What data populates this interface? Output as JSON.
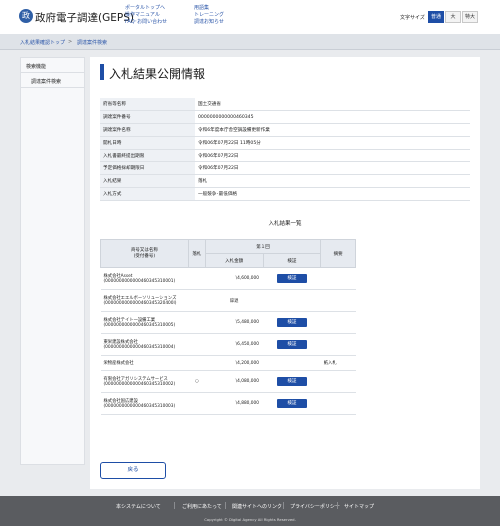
{
  "header": {
    "logo_glyph": "政",
    "title": "政府電子調達(GEPS)",
    "links_col1": [
      "ポータルトップへ",
      "操作マニュアル",
      "FAQ･お問い合わせ"
    ],
    "links_col2": [
      "用語集",
      "トレーニング",
      "調達お知らせ"
    ],
    "font_size_label": "文字サイズ",
    "font_sizes": [
      "普通",
      "大",
      "特大"
    ]
  },
  "breadcrumb": {
    "items": [
      "入札結果確認トップ",
      "調達案件検索"
    ],
    "separator": ">"
  },
  "sidebar": {
    "heading": "検索機能",
    "items": [
      "調達案件検索"
    ]
  },
  "page": {
    "title": "入札結果公開情報",
    "info": [
      {
        "label": "府省等名称",
        "value": "国土交通省"
      },
      {
        "label": "調達案件番号",
        "value": "0000000000000460345"
      },
      {
        "label": "調達案件名称",
        "value": "令和6年度本庁舎空調設備更新作業"
      },
      {
        "label": "開札日時",
        "value": "令和06年07月22日 11時05分"
      },
      {
        "label": "入札書最終提出期限",
        "value": "令和06年07月22日"
      },
      {
        "label": "予定価格採却期限日",
        "value": "令和06年07月22日"
      },
      {
        "label": "入札結果",
        "value": "落札"
      },
      {
        "label": "入札方式",
        "value": "一般競争･最低価格"
      }
    ],
    "results_title": "入札結果一覧",
    "results_headers": {
      "company": "商号又は名称\n(受付番号)",
      "award": "落札",
      "round": "第１回",
      "amount": "入札金額",
      "verify": "検証",
      "remarks": "摘要"
    },
    "results": [
      {
        "name": "株式会社Asset",
        "id": "(0000000000000460345310001)",
        "award": "",
        "amount": "\\4,600,000",
        "verify": "検証",
        "remarks": ""
      },
      {
        "name": "株式会社エエルボーソリューションズ",
        "id": "(0000000000000460345320400l)",
        "award": "",
        "amount": "",
        "note": "辞退",
        "verify": "",
        "remarks": ""
      },
      {
        "name": "株式会社テイト一設備工業",
        "id": "(0000000000000460345310005)",
        "award": "",
        "amount": "\\5,480,000",
        "verify": "検証",
        "remarks": ""
      },
      {
        "name": "東栄建設株式会社",
        "id": "(0000000000000460345310004)",
        "award": "",
        "amount": "\\6,450,000",
        "verify": "検証",
        "remarks": ""
      },
      {
        "name": "栄物産株式会社",
        "id": "",
        "award": "",
        "amount": "\\4,200,000",
        "verify": "",
        "remarks": "紙入札"
      },
      {
        "name": "有限会社アガリシステムサービス",
        "id": "(0000000000000460345310002)",
        "award": "○",
        "amount": "\\4,080,000",
        "verify": "検証",
        "remarks": ""
      },
      {
        "name": "株式会社国広建設",
        "id": "(0000000000000460345310003)",
        "award": "",
        "amount": "\\4,880,000",
        "verify": "検証",
        "remarks": ""
      }
    ],
    "back_label": "戻る"
  },
  "footer": {
    "links": [
      "本システムについて",
      "ご利用にあたって",
      "関連サイトへのリンク",
      "プライバシーポリシー",
      "サイトマップ"
    ],
    "copyright": "Copyright © Digital Agency All Rights Reserved."
  },
  "colors": {
    "accent": "#1e4ea6",
    "footer": "#5a5c60"
  }
}
